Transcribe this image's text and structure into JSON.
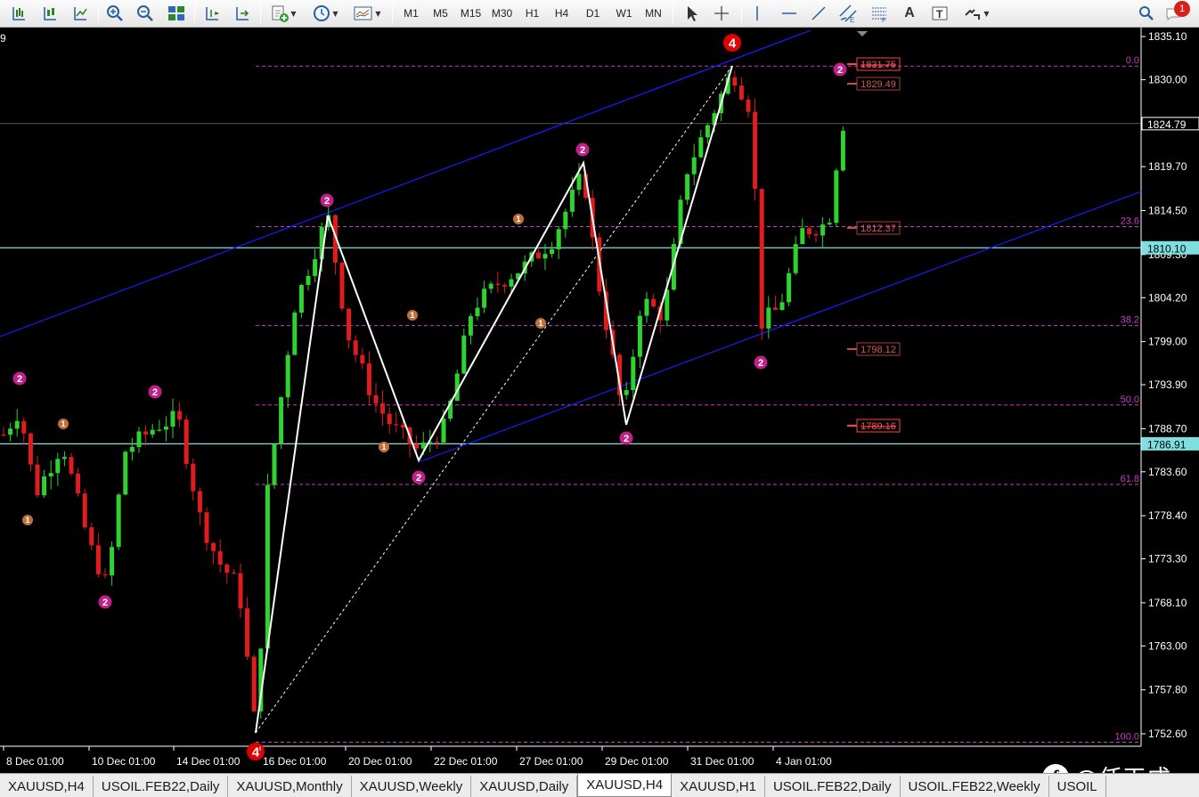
{
  "toolbar": {
    "timeframes": [
      "M1",
      "M5",
      "M15",
      "M30",
      "H1",
      "H4",
      "D1",
      "W1",
      "MN"
    ],
    "text_tool_label": "A",
    "notification_count": "1"
  },
  "chart": {
    "symbol_fragment": "9",
    "price_axis": [
      "1835.10",
      "1830.00",
      "1824.79",
      "1819.70",
      "1814.50",
      "1809.30",
      "1804.20",
      "1799.00",
      "1793.90",
      "1788.70",
      "1783.60",
      "1778.40",
      "1773.30",
      "1768.10",
      "1763.00",
      "1757.80",
      "1752.60"
    ],
    "price_markers": [
      {
        "value": "1824.79",
        "color": "#ffffff"
      },
      {
        "value": "1810.10",
        "color": "#7fdfe0"
      },
      {
        "value": "1786.91",
        "color": "#7fdfe0"
      }
    ],
    "time_axis": [
      "8 Dec 01:00",
      "10 Dec 01:00",
      "14 Dec 01:00",
      "16 Dec 01:00",
      "20 Dec 01:00",
      "22 Dec 01:00",
      "27 Dec 01:00",
      "29 Dec 01:00",
      "31 Dec 01:00",
      "4 Jan 01:00"
    ],
    "fib_levels": [
      "0.0",
      "23.6",
      "38.2",
      "50.0",
      "61.8",
      "100.0"
    ],
    "price_labels": [
      "1831.75",
      "1829.49",
      "1812.37",
      "1798.12",
      "1789.16"
    ],
    "wave_labels": [
      "4",
      "2",
      "1"
    ],
    "colors": {
      "background": "#000000",
      "bull_candle": "#2fd22f",
      "bear_candle": "#e01c1c",
      "fib": "#c83cc8",
      "channel": "#1a1aff",
      "wave_line": "#ffffff",
      "horizontal_line": "#7fdfe0"
    }
  },
  "watermark": "@任天成",
  "tabs": [
    "XAUUSD,H4",
    "USOIL.FEB22,Daily",
    "XAUUSD,Monthly",
    "XAUUSD,Weekly",
    "XAUUSD,Daily",
    "XAUUSD,H4",
    "XAUUSD,H1",
    "USOIL.FEB22,Daily",
    "USOIL.FEB22,Weekly",
    "USOIL"
  ],
  "active_tab_index": 5
}
